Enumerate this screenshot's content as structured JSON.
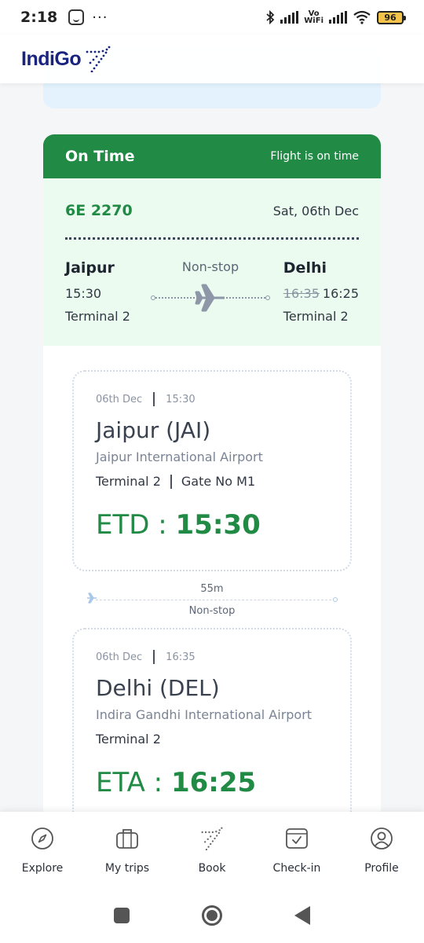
{
  "status_bar": {
    "time": "2:18",
    "dots": "···",
    "vowifi": "Vo\nWiFi",
    "battery": "96"
  },
  "header": {
    "logo_text": "IndiGo"
  },
  "flight": {
    "status": "On Time",
    "status_note": "Flight is on time",
    "flight_number": "6E 2270",
    "date": "Sat, 06th Dec",
    "route_type": "Non-stop",
    "origin": {
      "city": "Jaipur",
      "time": "15:30",
      "terminal": "Terminal 2"
    },
    "destination": {
      "city": "Delhi",
      "old_time": "16:35",
      "time": "16:25",
      "terminal": "Terminal 2"
    }
  },
  "departure": {
    "date": "06th Dec",
    "time": "15:30",
    "city_code": "Jaipur (JAI)",
    "airport": "Jaipur International Airport",
    "terminal": "Terminal 2",
    "gate": "Gate No M1",
    "label": "ETD :",
    "etd": "15:30"
  },
  "duration": {
    "time": "55m",
    "type": "Non-stop"
  },
  "arrival": {
    "date": "06th Dec",
    "time": "16:35",
    "city_code": "Delhi (DEL)",
    "airport": "Indira Gandhi International Airport",
    "terminal": "Terminal 2",
    "label": "ETA :",
    "eta": "16:25"
  },
  "nav": {
    "items": [
      {
        "label": "Explore",
        "icon": "compass-icon"
      },
      {
        "label": "My trips",
        "icon": "suitcase-icon"
      },
      {
        "label": "Book",
        "icon": "plane-dots-icon"
      },
      {
        "label": "Check-in",
        "icon": "boarding-pass-icon"
      },
      {
        "label": "Profile",
        "icon": "user-icon"
      }
    ]
  },
  "colors": {
    "green": "#218a45",
    "mint": "#ebfbf0",
    "navy": "#1a237e",
    "light_blue": "#e3f2fd"
  }
}
